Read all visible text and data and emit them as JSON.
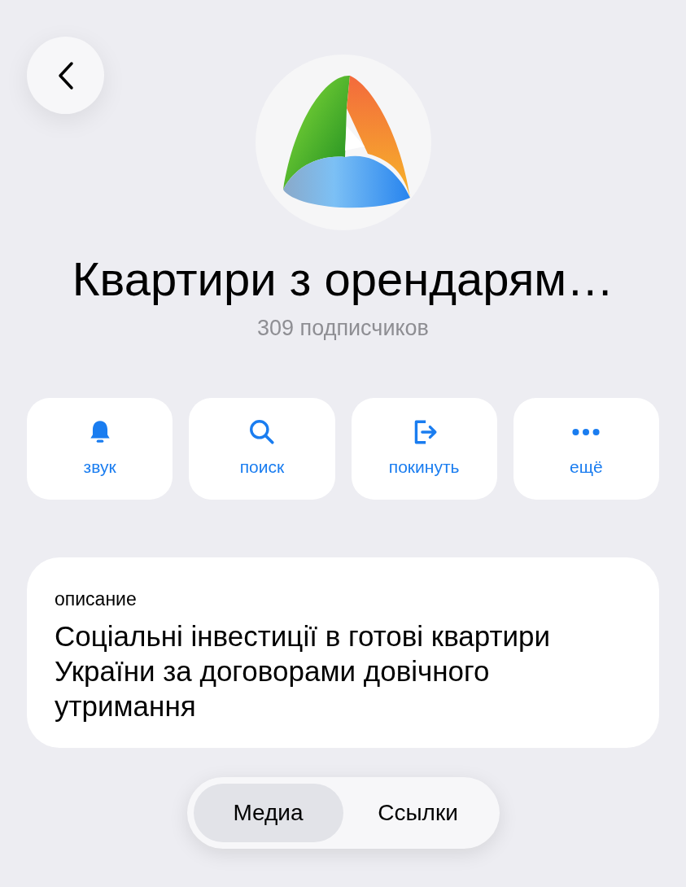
{
  "channel": {
    "title": "Квартири з орендарям…",
    "subscribers": "309 подписчиков"
  },
  "actions": [
    {
      "kind": "bell",
      "label": "звук"
    },
    {
      "kind": "search",
      "label": "поиск"
    },
    {
      "kind": "leave",
      "label": "покинуть"
    },
    {
      "kind": "more",
      "label": "ещё"
    }
  ],
  "description": {
    "label": "описание",
    "text": "Соціальні інвестиції в готові квартири України за договорами довічного утримання"
  },
  "tabs": [
    {
      "label": "Медиа",
      "selected": true
    },
    {
      "label": "Ссылки",
      "selected": false
    }
  ]
}
